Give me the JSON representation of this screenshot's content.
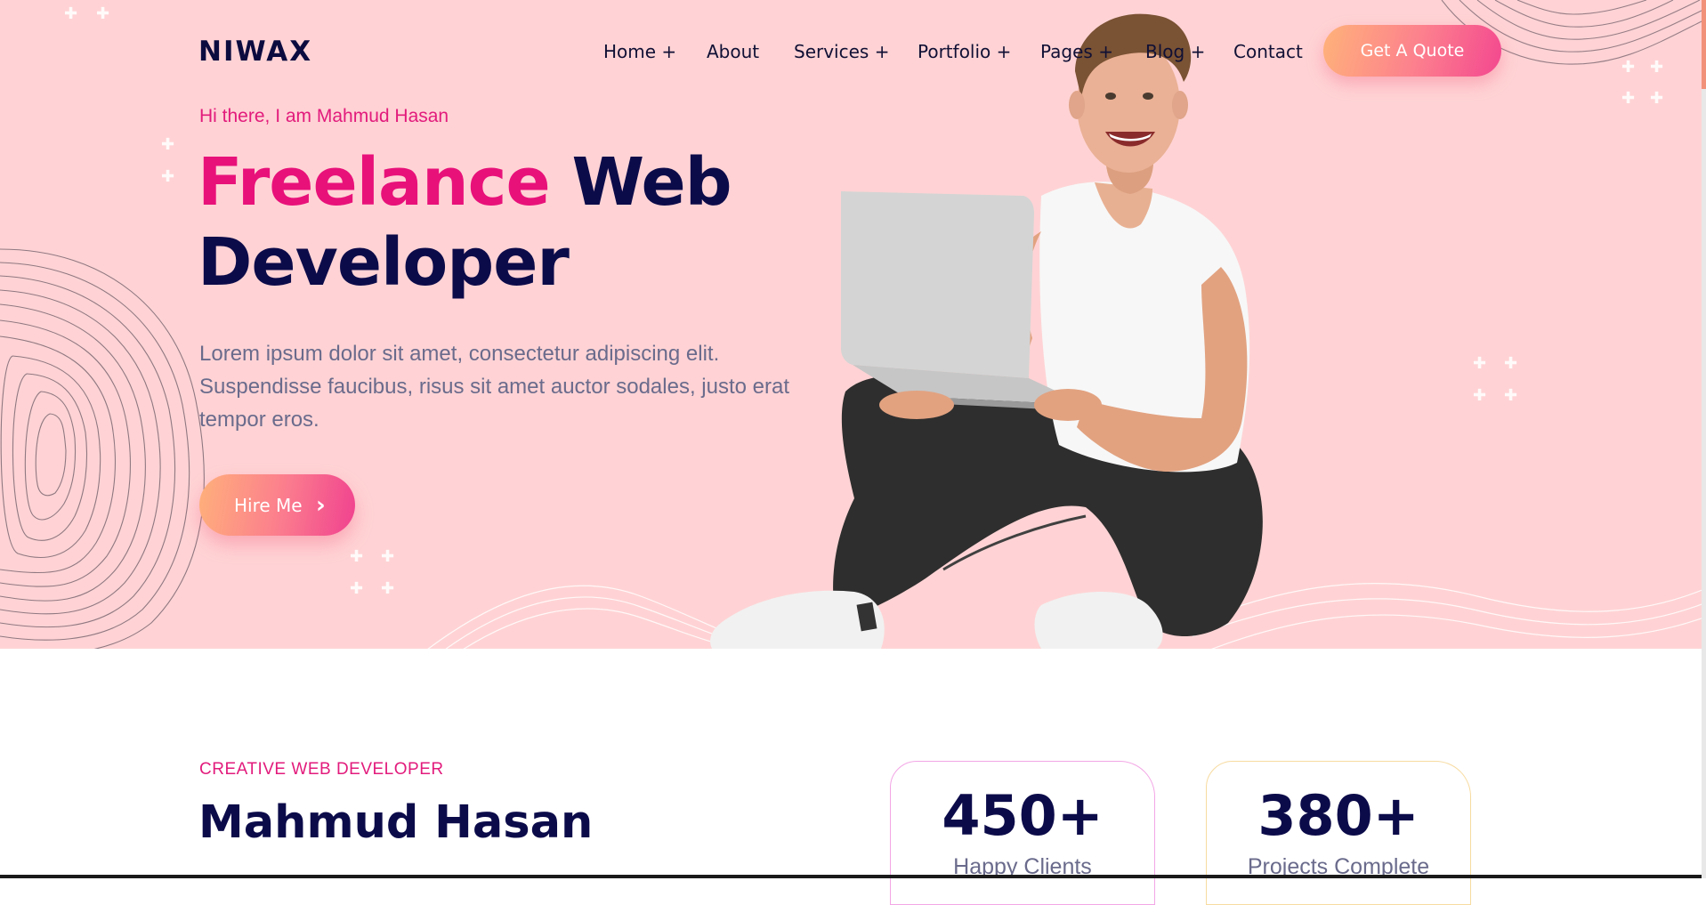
{
  "brand": {
    "logo": "NIWAX",
    "accent": "#e8117a",
    "dark": "#0c0b4a"
  },
  "nav": {
    "items": [
      {
        "label": "Home +"
      },
      {
        "label": "About"
      },
      {
        "label": "Services +"
      },
      {
        "label": "Portfolio +"
      },
      {
        "label": "Pages +"
      },
      {
        "label": "Blog +"
      },
      {
        "label": "Contact"
      }
    ],
    "cta": "Get A Quote"
  },
  "hero": {
    "greeting": "Hi there, I am Mahmud Hasan",
    "headline_highlight": "Freelance",
    "headline_rest": "Web Developer",
    "description": "Lorem ipsum dolor sit amet, consectetur adipiscing elit. Suspendisse faucibus, risus sit amet auctor sodales, justo erat tempor eros.",
    "button": "Hire Me",
    "button_icon": "chevron-right-icon"
  },
  "about": {
    "eyebrow": "CREATIVE WEB DEVELOPER",
    "name": "Mahmud Hasan"
  },
  "stats": [
    {
      "value": "450+",
      "label": "Happy Clients"
    },
    {
      "value": "380+",
      "label": "Projects Complete"
    }
  ]
}
